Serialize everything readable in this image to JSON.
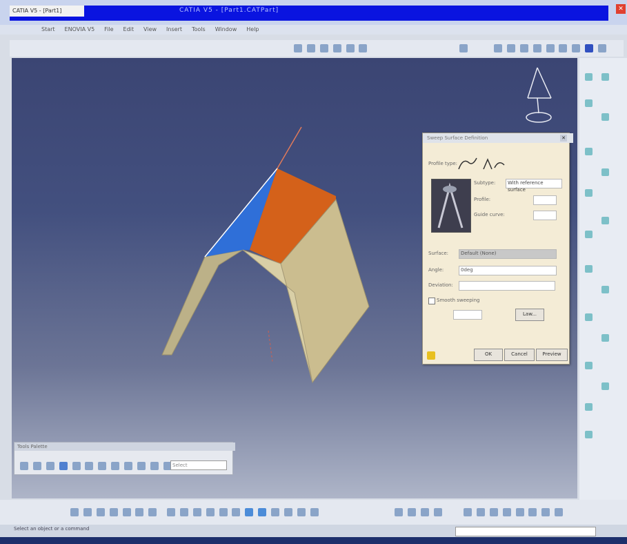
{
  "window": {
    "app_tab_label": "CATIA V5 - [Part1]",
    "title": "CATIA V5 - [Part1.CATPart]",
    "close_glyph": "✕"
  },
  "menu": [
    "Start",
    "ENOVIA V5",
    "File",
    "Edit",
    "View",
    "Insert",
    "Tools",
    "Window",
    "Help"
  ],
  "dialog": {
    "title": "Sweep Surface Definition",
    "profile_type_label": "Profile type:",
    "subtype_label": "Subtype:",
    "subtype_value": "With reference surface",
    "profile_label": "Profile:",
    "guide_label": "Guide curve:",
    "surface_label": "Surface:",
    "surface_value": "Default (None)",
    "angle_label": "Angle:",
    "angle_value": "0deg",
    "law_button": "Law...",
    "smooth_label": "Smooth sweeping",
    "deviation_label": "Deviation:",
    "buttons": {
      "ok": "OK",
      "cancel": "Cancel",
      "preview": "Preview"
    }
  },
  "float_toolbar": {
    "title": "Tools Palette",
    "input_value": "Select"
  },
  "status": {
    "message": "Select an object or a command",
    "command_input": ""
  },
  "colors": {
    "viewport_top": "#3b4573",
    "viewport_bottom": "#aeb5c8",
    "surface_orange": "#d4611a",
    "surface_blue": "#2f6fd8",
    "surface_beige": "#cbbd8f"
  }
}
